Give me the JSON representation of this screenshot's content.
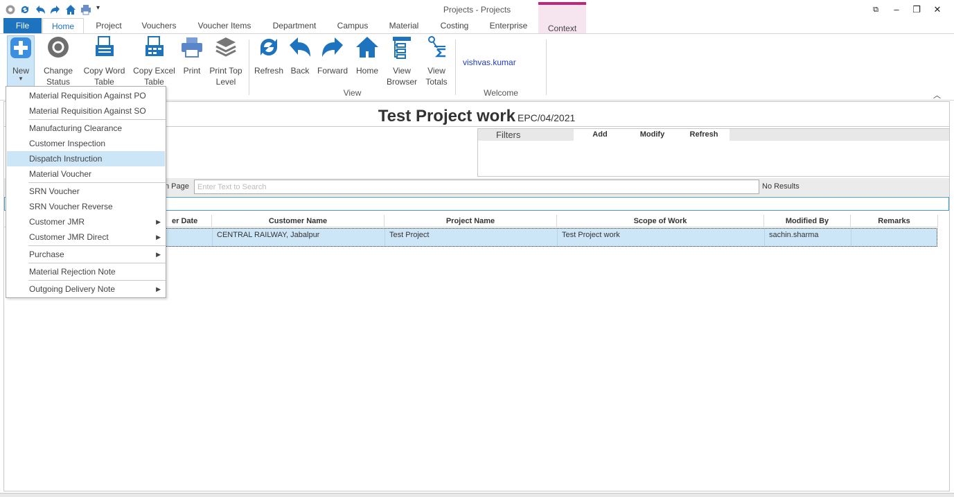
{
  "window": {
    "title": "Projects - Projects"
  },
  "tabs": {
    "file": "File",
    "home": "Home",
    "project": "Project",
    "vouchers": "Vouchers",
    "voucher_items": "Voucher Items",
    "department": "Department",
    "campus": "Campus",
    "material": "Material",
    "costing": "Costing",
    "enterprise": "Enterprise",
    "context": "Context"
  },
  "ribbon": {
    "new": "New",
    "change_status": "Change Status",
    "copy_word_table": "Copy Word Table",
    "copy_excel_table": "Copy Excel Table",
    "print": "Print",
    "print_top_level": "Print Top Level",
    "refresh": "Refresh",
    "back": "Back",
    "forward": "Forward",
    "home": "Home",
    "view_browser": "View Browser",
    "view_totals": "View Totals",
    "group_view": "View",
    "user": "vishvas.kumar",
    "group_welcome": "Welcome"
  },
  "header": {
    "title": "Test Project work",
    "code": "EPC/04/2021"
  },
  "filters": {
    "label": "Filters",
    "add": "Add",
    "modify": "Modify",
    "refresh": "Refresh"
  },
  "search": {
    "prefix": "n Page",
    "placeholder": "Enter Text to Search",
    "status": "No Results"
  },
  "grid": {
    "columns": [
      "er Date",
      "Customer Name",
      "Project Name",
      "Scope of Work",
      "Modified By",
      "Remarks"
    ],
    "rows": [
      {
        "customer": "CENTRAL RAILWAY, Jabalpur",
        "project": "Test Project",
        "scope": "Test Project work",
        "modified_by": "sachin.sharma",
        "remarks": ""
      }
    ]
  },
  "menu": {
    "items": [
      "Material Requisition Against PO",
      "Material Requisition Against SO",
      "Manufacturing Clearance",
      "Customer Inspection",
      "Dispatch Instruction",
      "Material Voucher",
      "SRN Voucher",
      "SRN Voucher Reverse",
      "Customer JMR",
      "Customer JMR Direct",
      "Purchase",
      "Material Rejection Note",
      "Outgoing Delivery Note"
    ],
    "highlighted": "Dispatch Instruction"
  },
  "colors": {
    "accent": "#1e73be",
    "context_tab": "#c0267b",
    "selection": "#cde6f7"
  }
}
